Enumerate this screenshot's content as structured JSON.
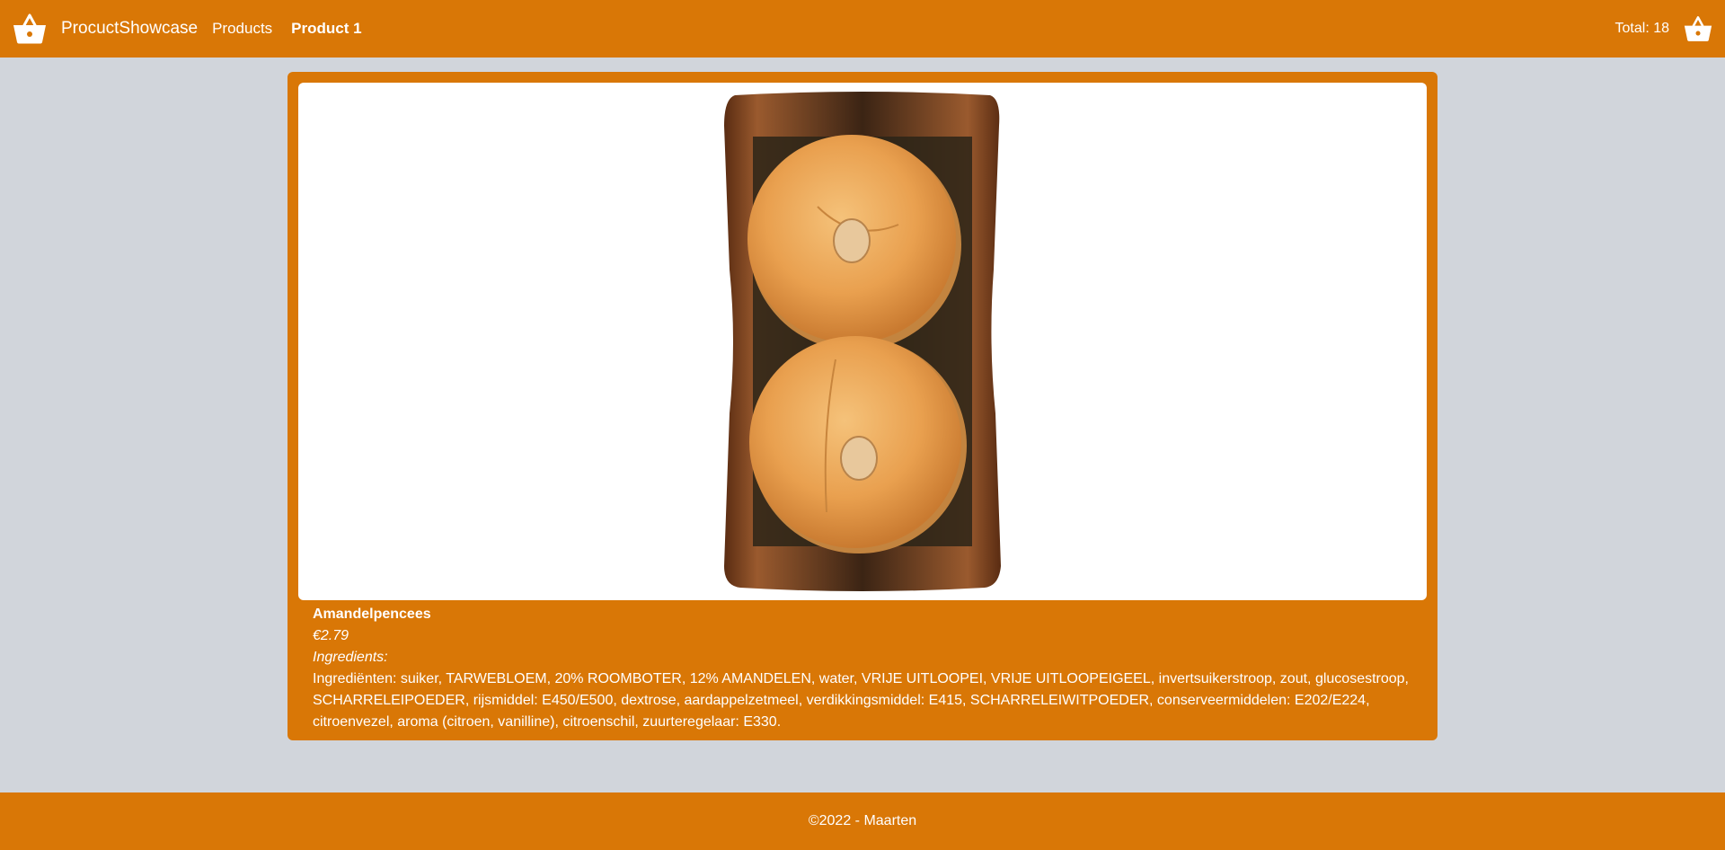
{
  "navbar": {
    "brand": "ProcuctShowcase",
    "logo_icon": "basket-icon",
    "links": [
      {
        "label": "Products"
      },
      {
        "label": "Product 1"
      }
    ],
    "total": "Total: 18",
    "cart_icon": "basket-icon"
  },
  "product": {
    "image_alt": "Amandelpencees",
    "name": "Amandelpencees",
    "price": "€2.79",
    "ingredients_label": "Ingredients:",
    "ingredients": "Ingrediënten: suiker, TARWEBLOEM, 20% ROOMBOTER, 12% AMANDELEN, water, VRIJE UITLOOPEI, VRIJE UITLOOPEIGEEL, invertsuikerstroop, zout, glucosestroop, SCHARRELEIPOEDER, rijsmiddel: E450/E500, dextrose, aardappelzetmeel, verdikkingsmiddel: E415, SCHARRELEIWITPOEDER, conserveermiddelen: E202/E224, citroenvezel, aroma (citroen, vanilline), citroenschil, zuurteregelaar: E330."
  },
  "footer": {
    "text": "©2022 - Maarten"
  },
  "colors": {
    "accent": "#d97706",
    "background": "#d1d5db"
  }
}
